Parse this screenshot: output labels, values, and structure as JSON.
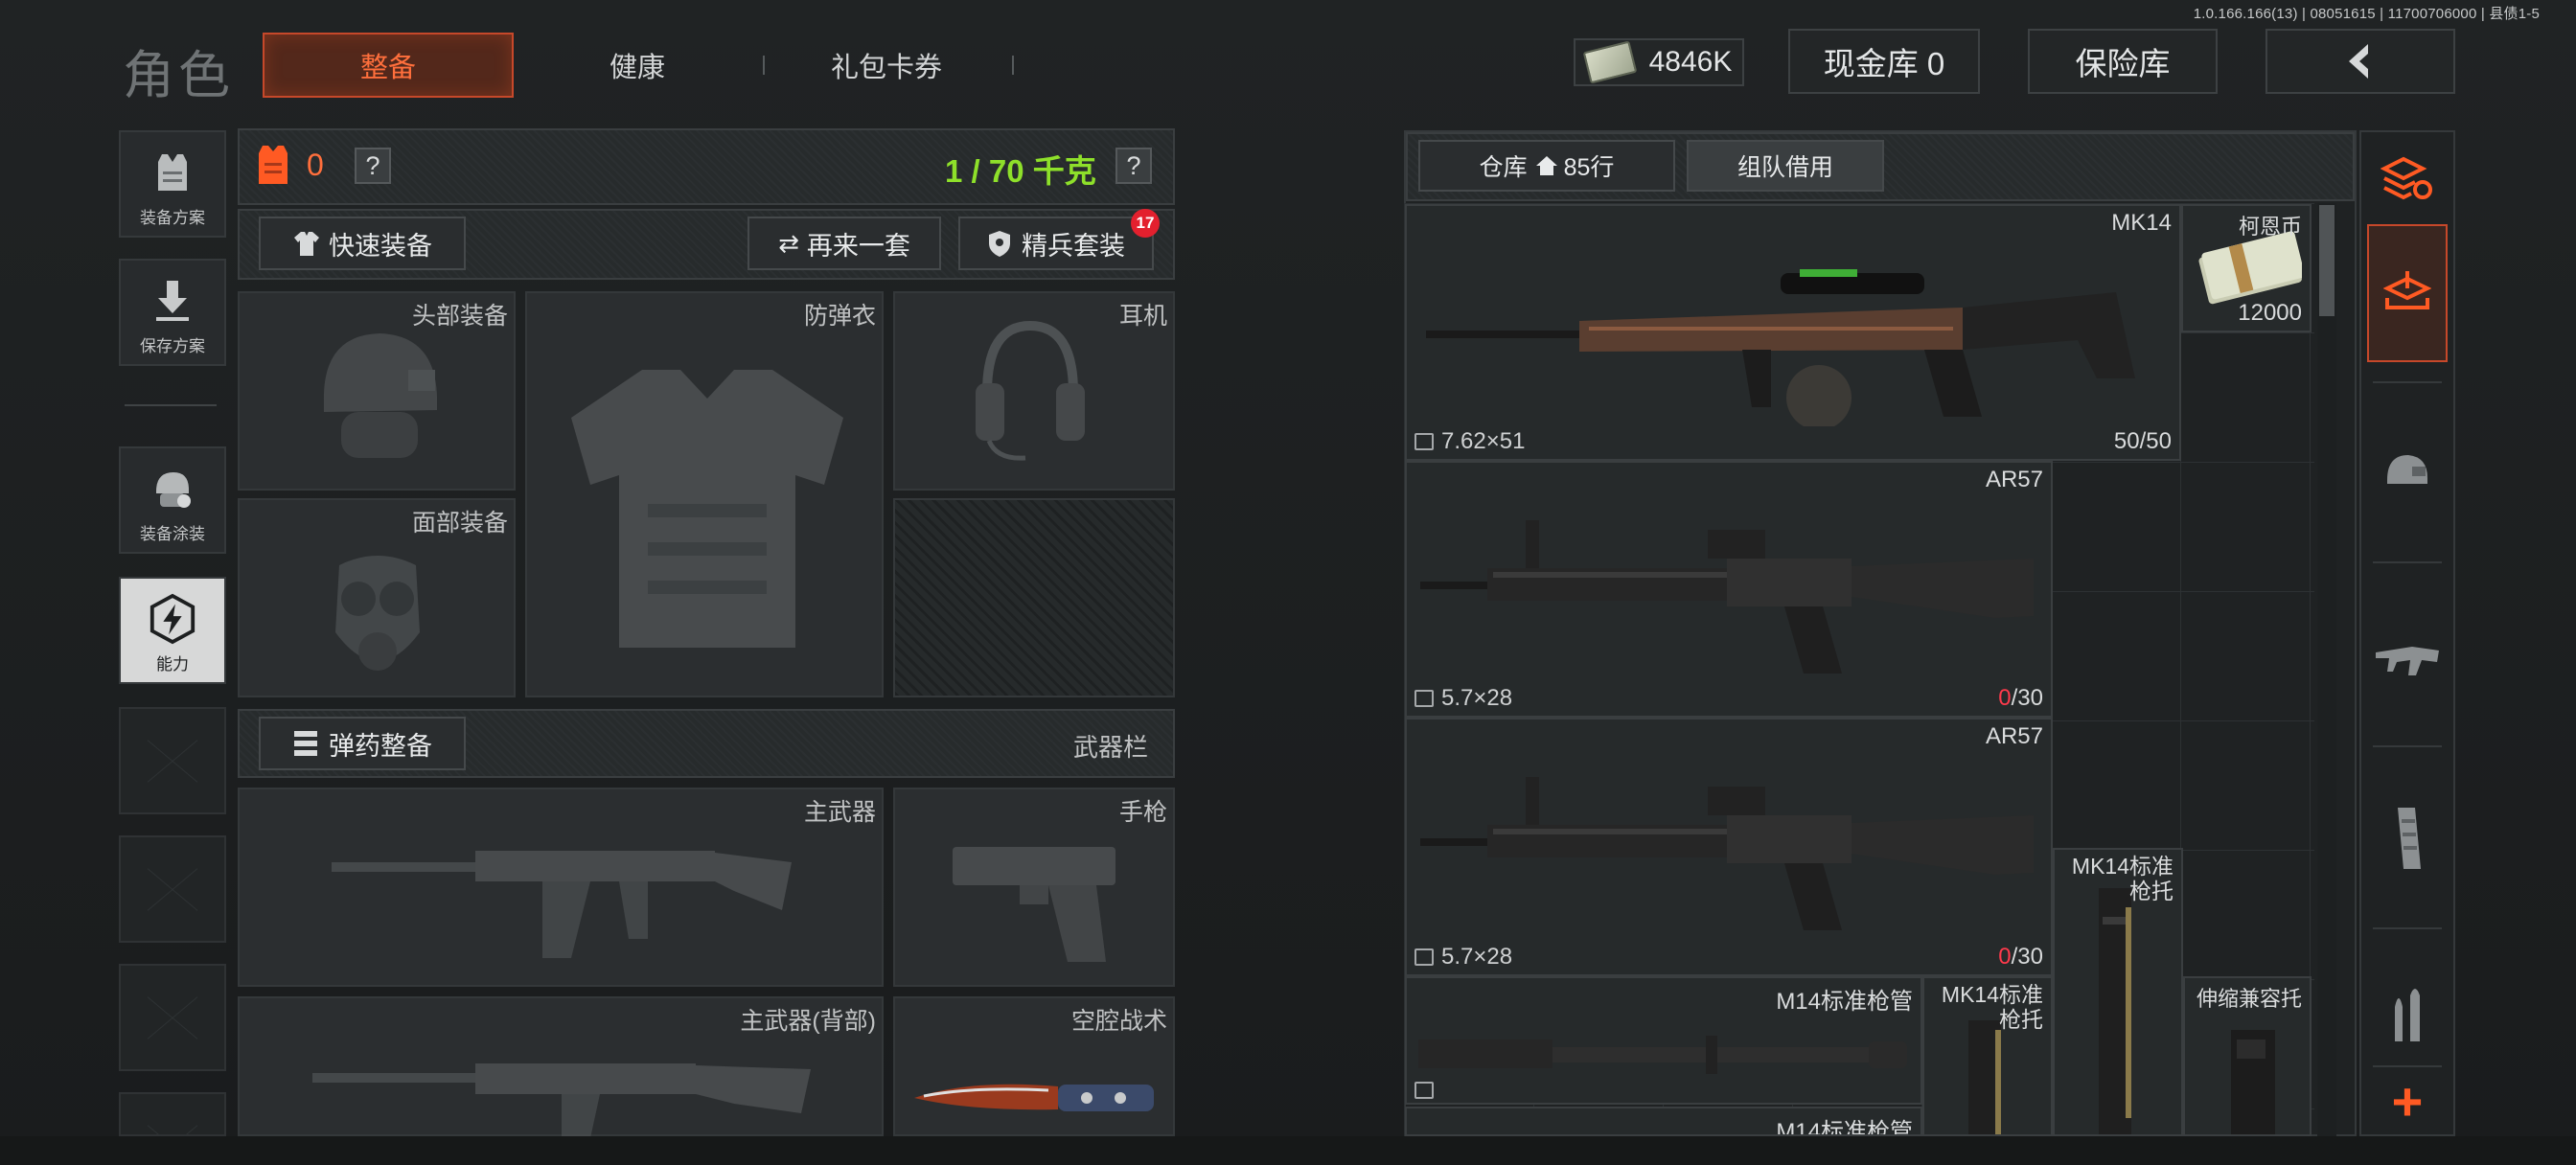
{
  "version": "1.0.166.166(13) | 08051615 | 11700706000 | 县债1-5",
  "header": {
    "title": "角色",
    "tabs": [
      {
        "label": "整备",
        "active": true
      },
      {
        "label": "健康",
        "active": false
      },
      {
        "label": "礼包卡券",
        "active": false
      }
    ],
    "money": "4846K",
    "cash_vault": "现金库 0",
    "insurance": "保险库",
    "back_icon": "chevron-left-icon"
  },
  "sidebar": {
    "items": [
      {
        "label": "装备方案",
        "icon": "vest-plan-icon"
      },
      {
        "label": "保存方案",
        "icon": "download-icon"
      },
      {
        "label": "装备涂装",
        "icon": "helmet-paint-icon"
      },
      {
        "label": "能力",
        "icon": "lightning-hex-icon"
      }
    ]
  },
  "loadout": {
    "armor_count": "0",
    "armor_help": "?",
    "weight": "1 / 70 千克",
    "weight_help": "?",
    "quick_equip": "快速装备",
    "again_set": "再来一套",
    "elite_set": "精兵套装",
    "elite_badge": "17",
    "slots": {
      "head": "头部装备",
      "vest": "防弹衣",
      "ear": "耳机",
      "face": "面部装备"
    },
    "ammo_equip": "弹药整备",
    "weapon_bar": "武器栏",
    "weapon_slots": {
      "primary": "主武器",
      "pistol": "手枪",
      "primary_back": "主武器(背部)",
      "melee": "空腔战术"
    }
  },
  "stash": {
    "tab_warehouse": "仓库",
    "rows": "85行",
    "tab_team": "组队借用",
    "items": [
      {
        "name": "MK14",
        "ammo": "7.62×51",
        "durability_current": "50",
        "durability_max": "/50"
      },
      {
        "name": "柯恩币",
        "value": "12000"
      },
      {
        "name": "AR57",
        "ammo": "5.7×28",
        "durability_current": "0",
        "durability_max": "/30"
      },
      {
        "name": "AR57",
        "ammo": "5.7×28",
        "durability_current": "0",
        "durability_max": "/30"
      },
      {
        "name": "MK14标准枪托"
      },
      {
        "name": "M14标准枪管"
      },
      {
        "name": "MK14标准枪托"
      },
      {
        "name": "伸缩兼容托"
      },
      {
        "name": "M14标准枪管"
      }
    ]
  },
  "rail": {
    "icons": [
      "stack-refresh-icon",
      "stash-tray-icon",
      "helmet-icon",
      "rifle-icon",
      "magazine-icon",
      "bullets-icon",
      "plus-icon"
    ]
  },
  "colors": {
    "accent": "#ff6f3c",
    "accent_border": "#c6482a",
    "weight_green": "#8ee02a",
    "zero_red": "#ff3a4c"
  }
}
